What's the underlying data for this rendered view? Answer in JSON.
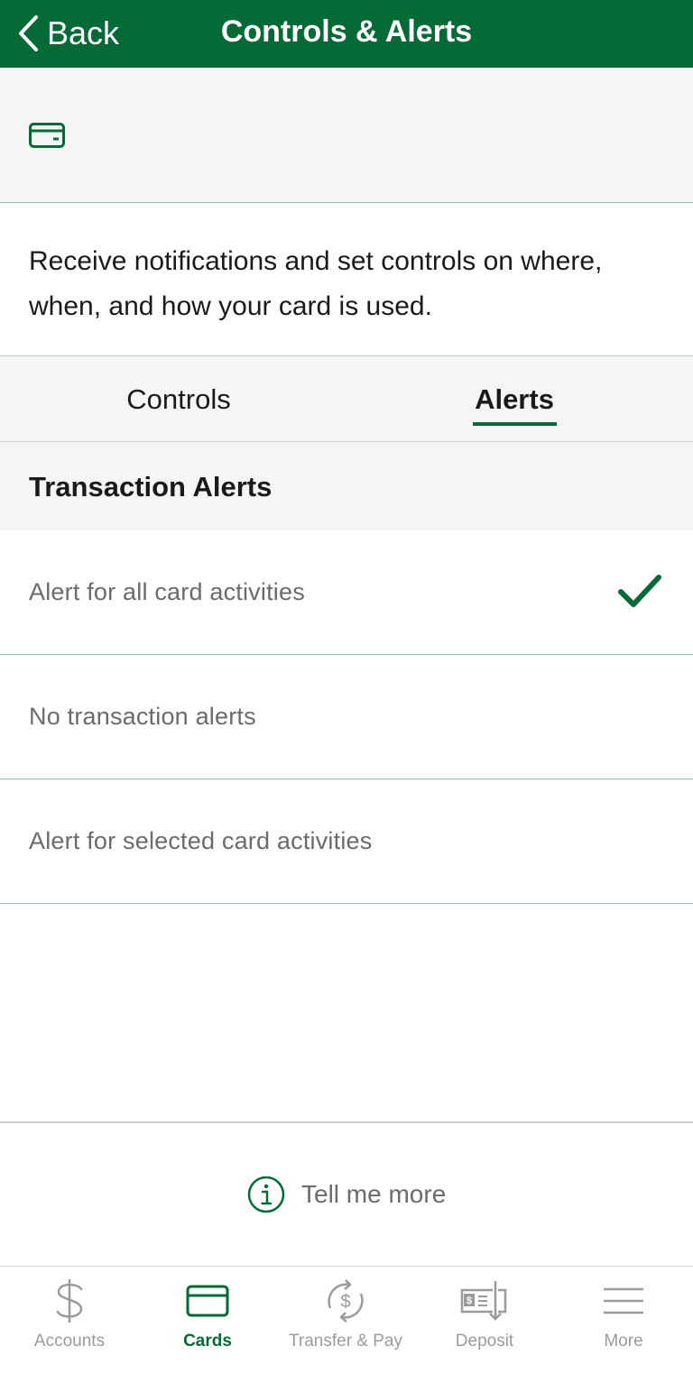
{
  "colors": {
    "brand": "#066a37",
    "muted": "#6b6b6b",
    "tab_inactive": "#9b9b9b"
  },
  "header": {
    "back_label": "Back",
    "title": "Controls & Alerts"
  },
  "card_strip": {
    "icon": "credit-card-icon"
  },
  "description": "Receive notifications and set controls on where, when, and how your card is used.",
  "tabs": [
    {
      "label": "Controls",
      "selected": false
    },
    {
      "label": "Alerts",
      "selected": true
    }
  ],
  "section": {
    "title": "Transaction Alerts"
  },
  "options": [
    {
      "label": "Alert for all card activities",
      "selected": true
    },
    {
      "label": "No transaction alerts",
      "selected": false
    },
    {
      "label": "Alert for selected card activities",
      "selected": false
    }
  ],
  "info": {
    "icon": "info-icon",
    "label": "Tell me more"
  },
  "tabbar": [
    {
      "label": "Accounts",
      "icon": "dollar-icon",
      "active": false
    },
    {
      "label": "Cards",
      "icon": "credit-card-icon",
      "active": true
    },
    {
      "label": "Transfer & Pay",
      "icon": "transfer-dollar-icon",
      "active": false
    },
    {
      "label": "Deposit",
      "icon": "check-deposit-icon",
      "active": false
    },
    {
      "label": "More",
      "icon": "menu-icon",
      "active": false
    }
  ]
}
